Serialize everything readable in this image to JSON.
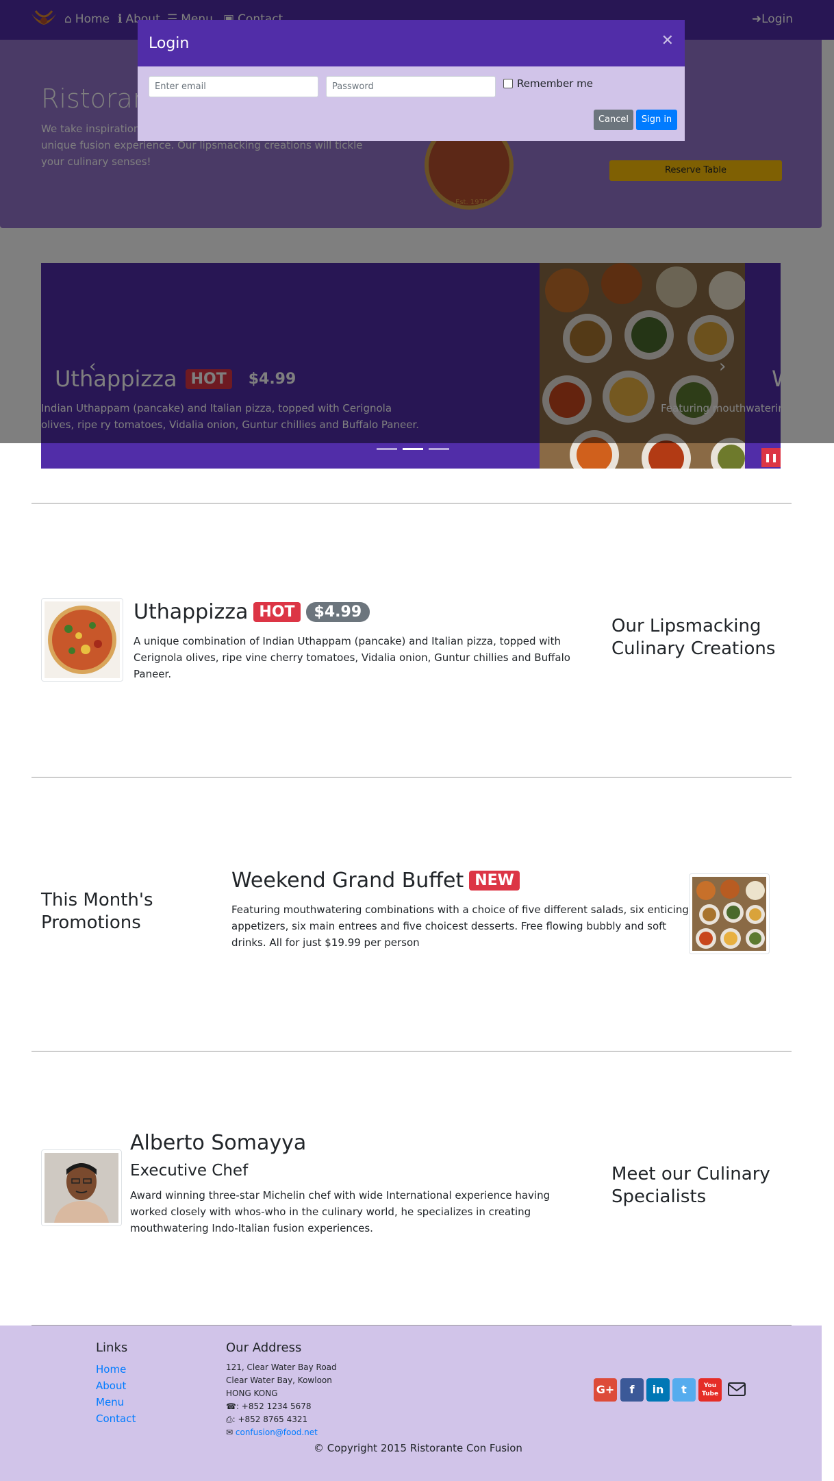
{
  "navbar": {
    "home": "Home",
    "about": "About",
    "menu": "Menu",
    "contact": "Contact",
    "login": "Login"
  },
  "jumbotron": {
    "title": "Ristorante con Fusion",
    "text": "We take inspiration from the World's best cuisines, and create a unique fusion experience. Our lipsmacking creations will tickle your culinary senses!",
    "logo_text": "Est. 1975",
    "reserve_button": "Reserve Table"
  },
  "carousel": {
    "title": "Uthappizza",
    "badge": "HOT",
    "price": "$4.99",
    "description": "Indian Uthappam (pancake) and Italian pizza, topped with Cerignola olives, ripe ry tomatoes, Vidalia onion, Guntur chillies and Buffalo Paneer.",
    "next_title": "W",
    "next_description": "Featuring mouthwatering main entrees and five choi"
  },
  "modal": {
    "title": "Login",
    "email_placeholder": "Enter email",
    "password_placeholder": "Password",
    "remember_label": "Remember me",
    "cancel": "Cancel",
    "signin": "Sign in"
  },
  "dish": {
    "name": "Uthappizza",
    "badge": "HOT",
    "price": "$4.99",
    "description": "A unique combination of Indian Uthappam (pancake) and Italian pizza, topped with Cerignola olives, ripe vine cherry tomatoes, Vidalia onion, Guntur chillies and Buffalo Paneer.",
    "side_heading": "Our Lipsmacking Culinary Creations"
  },
  "promotion": {
    "side_heading": "This Month's Promotions",
    "name": "Weekend Grand Buffet",
    "badge": "NEW",
    "description": "Featuring mouthwatering combinations with a choice of five different salads, six enticing appetizers, six main entrees and five choicest desserts. Free flowing bubbly and soft drinks. All for just $19.99 per person"
  },
  "leader": {
    "name": "Alberto Somayya",
    "designation": "Executive Chef",
    "description": "Award winning three-star Michelin chef with wide International experience having worked closely with whos-who in the culinary world, he specializes in creating mouthwatering Indo-Italian fusion experiences.",
    "side_heading": "Meet our Culinary Specialists"
  },
  "footer": {
    "links_heading": "Links",
    "links": [
      "Home",
      "About",
      "Menu",
      "Contact"
    ],
    "address_heading": "Our Address",
    "address_line1": "121, Clear Water Bay Road",
    "address_line2": "Clear Water Bay, Kowloon",
    "address_line3": "HONG KONG",
    "phone": ": +852 1234 5678",
    "fax": ": +852 8765 4321",
    "email": "confusion@food.net",
    "copyright": "© Copyright 2015 Ristorante Con Fusion",
    "social": [
      "G+",
      "f",
      "in",
      "t",
      "You Tube"
    ]
  }
}
